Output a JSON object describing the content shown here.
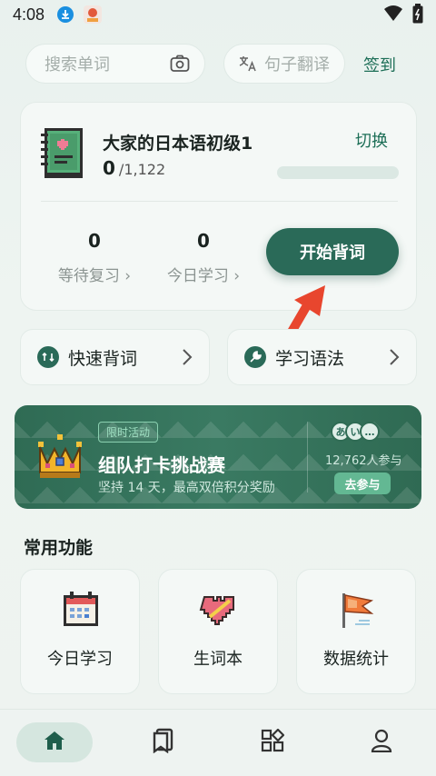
{
  "status_bar": {
    "time": "4:08"
  },
  "header": {
    "search_placeholder": "搜索单词",
    "translate_label": "句子翻译",
    "signin_label": "签到"
  },
  "book": {
    "title": "大家的日本语初级1",
    "switch_label": "切换",
    "learned": "0",
    "total": "/1,122",
    "progress": 0.0,
    "review_count": "0",
    "review_label": "等待复习 ›",
    "today_count": "0",
    "today_label": "今日学习 ›",
    "start_button": "开始背词"
  },
  "quick": {
    "fast_label": "快速背词",
    "grammar_label": "学习语法"
  },
  "banner": {
    "tag": "限时活动",
    "title": "组队打卡挑战赛",
    "subtitle": "坚持 14 天，最高双倍积分奖励",
    "avatars": [
      "あ",
      "い",
      "…"
    ],
    "participants": "12,762人参与",
    "join_button": "去参与"
  },
  "functions": {
    "title": "常用功能",
    "items": [
      {
        "label": "今日学习",
        "icon": "calendar-icon"
      },
      {
        "label": "生词本",
        "icon": "heart-icon"
      },
      {
        "label": "数据统计",
        "icon": "flag-icon"
      }
    ]
  },
  "nav": {
    "items": [
      "home-icon",
      "bookmark-icon",
      "apps-icon",
      "profile-icon"
    ]
  },
  "colors": {
    "accent": "#2a6a58",
    "link": "#1c6e56",
    "arrow": "#e8462e"
  }
}
